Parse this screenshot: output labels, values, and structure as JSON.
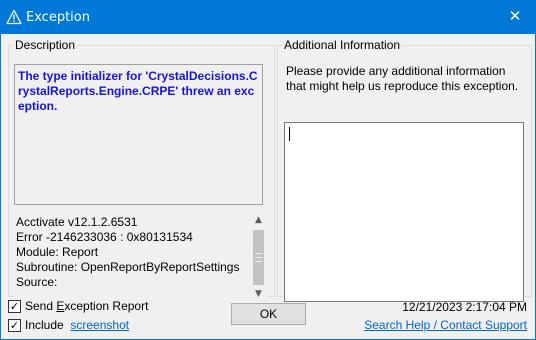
{
  "window": {
    "title": "Exception",
    "title_icon": "warning-icon",
    "close_symbol": "✕",
    "titlebar_color": "#0078d7"
  },
  "description": {
    "legend": "Description",
    "message": "The type initializer for 'CrystalDecisions.CrystalReports.Engine.CRPE' threw an exception.",
    "message_color": "#1414dc",
    "details": [
      "Acctivate v12.1.2.6531",
      "Error -2146233036 : 0x80131534",
      "Module: Report",
      "Subroutine: OpenReportByReportSettings",
      "Source:"
    ]
  },
  "additional": {
    "legend": "Additional Information",
    "prompt": "Please provide any additional information that might help us reproduce this exception.",
    "textarea_value": ""
  },
  "footer": {
    "send_report": {
      "label_pre": "Send ",
      "label_underline": "E",
      "label_post": "xception Report",
      "checked": true
    },
    "include": {
      "label": "Include",
      "link": "screenshot",
      "checked": true
    },
    "ok_label": "OK",
    "timestamp": "12/21/2023 2:17:04 PM",
    "search_link": "Search Help / Contact Support",
    "link_color": "#0066cc"
  }
}
